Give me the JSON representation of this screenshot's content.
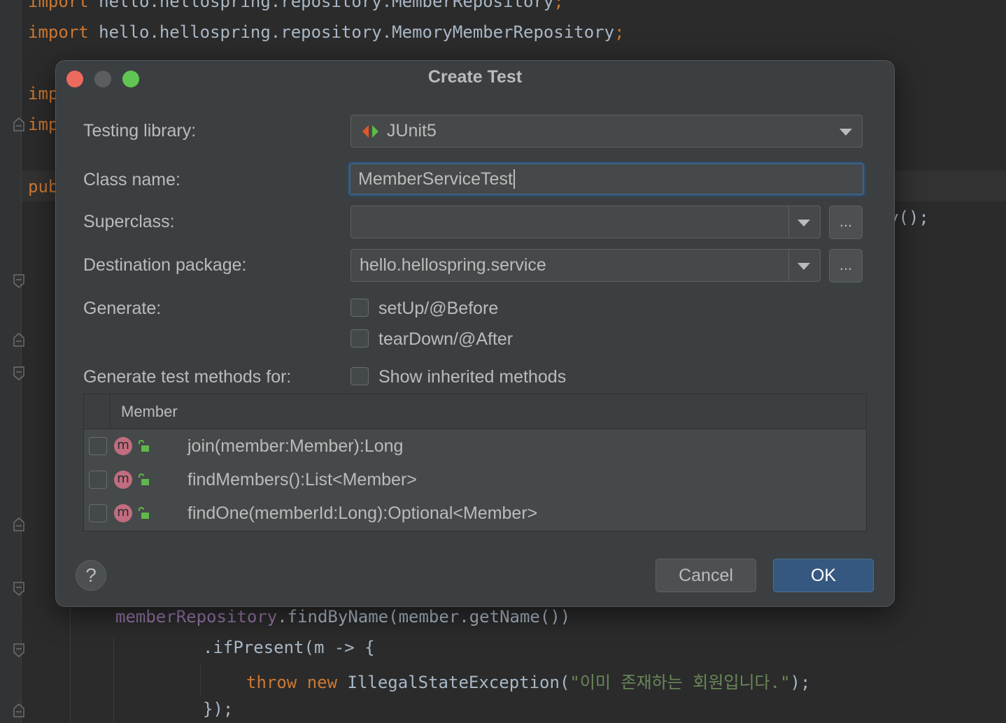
{
  "editor": {
    "line1": {
      "kw": "import",
      "rest": " hello.hellospring.repository.MemberRepository",
      "semi": ";"
    },
    "line2": {
      "kw": "import",
      "rest": " hello.hellospring.repository.MemoryMemberRepository",
      "semi": ";"
    },
    "line3_partial": "imp",
    "line4_partial": "imp",
    "line5_partial": "pub",
    "line6_suffix": "y();",
    "line7": {
      "field": "memberRepository",
      "rest": ".findByName(member.getName())"
    },
    "line8": ".ifPresent(m -> {",
    "line9": {
      "kw1": "throw",
      "kw2": "new",
      "rest": " IllegalStateException(",
      "str": "\"이미 존재하는 회원입니다.\"",
      "end": ");"
    },
    "line10": "});"
  },
  "dialog": {
    "title": "Create Test",
    "testing_library": {
      "label": "Testing library:",
      "value": "JUnit5"
    },
    "class_name": {
      "label": "Class name:",
      "value": "MemberServiceTest"
    },
    "superclass": {
      "label": "Superclass:",
      "value": "",
      "browse": "..."
    },
    "destination_package": {
      "label": "Destination package:",
      "value": "hello.hellospring.service",
      "browse": "..."
    },
    "generate": {
      "label": "Generate:",
      "options": [
        "setUp/@Before",
        "tearDown/@After"
      ]
    },
    "methods_for": {
      "label": "Generate test methods for:",
      "show_inherited": "Show inherited methods"
    },
    "table": {
      "header": "Member",
      "rows": [
        "join(member:Member):Long",
        "findMembers():List<Member>",
        "findOne(memberId:Long):Optional<Member>"
      ]
    },
    "help": "?",
    "cancel": "Cancel",
    "ok": "OK"
  },
  "colors": {
    "accent": "#365880",
    "focus": "#3d6185",
    "method_icon": "#c16c7f",
    "junit_left": "#e0572a",
    "junit_right": "#5fb84a"
  }
}
